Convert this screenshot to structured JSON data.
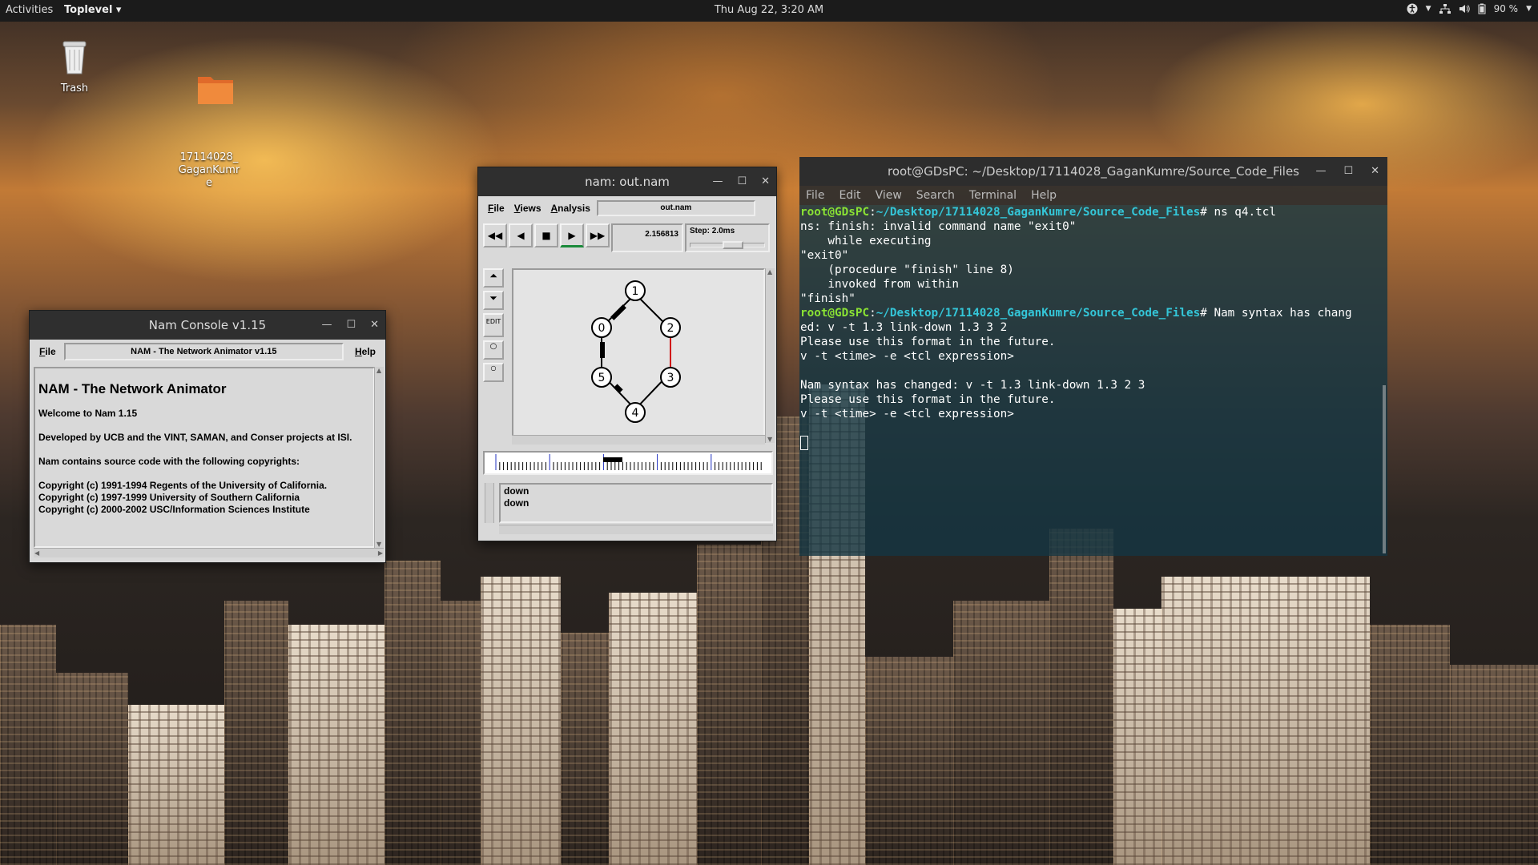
{
  "topbar": {
    "activities": "Activities",
    "app_menu": "Toplevel",
    "clock": "Thu Aug 22,  3:20 AM",
    "battery": "90 %"
  },
  "desktop": {
    "icons": [
      {
        "label": "Trash",
        "icon": "trash-icon"
      },
      {
        "label": "17114028_\nGaganKumr\ne",
        "icon": "folder-icon"
      }
    ]
  },
  "nam_console": {
    "title": "Nam Console v1.15",
    "menu_file": "File",
    "menu_label": "NAM - The Network Animator v1.15",
    "menu_help": "Help",
    "heading": "NAM - The Network Animator",
    "welcome": "Welcome to Nam 1.15",
    "developed": "Developed by UCB and the VINT, SAMAN, and Conser projects at ISI.",
    "contains": "Nam contains source code with the following copyrights:",
    "copyright1": "Copyright (c) 1991-1994 Regents of the University of California.",
    "copyright2": "Copyright (c) 1997-1999 University of Southern California",
    "copyright3": "Copyright (c) 2000-2002 USC/Information Sciences Institute"
  },
  "nam_main": {
    "title": "nam: out.nam",
    "menu_file": "File",
    "menu_views": "Views",
    "menu_analysis": "Analysis",
    "filename": "out.nam",
    "time": "2.156813",
    "step": "Step: 2.0ms",
    "edit_label": "EDIT",
    "nodes": [
      "0",
      "1",
      "2",
      "3",
      "4",
      "5"
    ],
    "log_lines": [
      "down",
      "down"
    ]
  },
  "terminal": {
    "title": "root@GDsPC: ~/Desktop/17114028_GaganKumre/Source_Code_Files",
    "menu": [
      "File",
      "Edit",
      "View",
      "Search",
      "Terminal",
      "Help"
    ],
    "prompt_user": "root@GDsPC",
    "prompt_path": "~/Desktop/17114028_GaganKumre/Source_Code_Files",
    "cmd1": "# ns q4.tcl",
    "out1": "ns: finish: invalid command name \"exit0\"",
    "out2": "    while executing",
    "out3": "\"exit0\"",
    "out4": "    (procedure \"finish\" line 8)",
    "out5": "    invoked from within",
    "out6": "\"finish\"",
    "cmd2": "# Nam syntax has chang",
    "out7": "ed: v -t 1.3 link-down 1.3 3 2",
    "out8": "Please use this format in the future.",
    "out9": "v -t <time> -e <tcl expression>",
    "out10": "",
    "out11": "Nam syntax has changed: v -t 1.3 link-down 1.3 2 3",
    "out12": "Please use this format in the future.",
    "out13": "v -t <time> -e <tcl expression>"
  }
}
